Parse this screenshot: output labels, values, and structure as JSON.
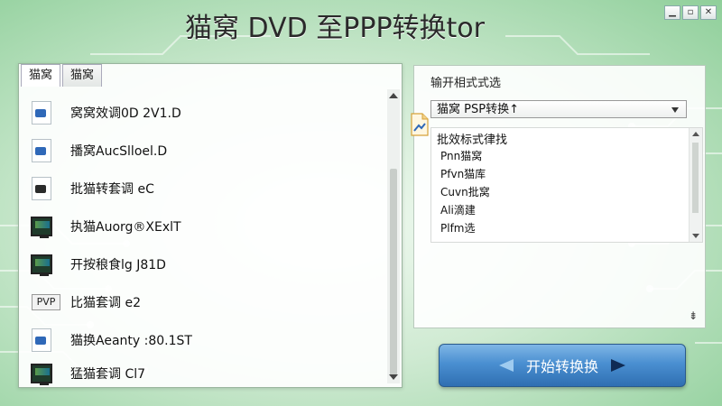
{
  "window": {
    "title": "猫窝 DVD 至PPP转换tor",
    "controls": {
      "minimize": "▁",
      "restore": "▫",
      "close": "✕"
    }
  },
  "left_panel": {
    "tabs": [
      {
        "label": "猫窝",
        "active": true
      },
      {
        "label": "猫窝",
        "active": false
      }
    ],
    "items": [
      {
        "icon": "video-file-icon",
        "label": "窝窝效调0D 2V1.D"
      },
      {
        "icon": "video-file-icon",
        "label": "播窝AucSlloel.D"
      },
      {
        "icon": "video-file-dark-icon",
        "label": "批猫转套调 eC"
      },
      {
        "icon": "monitor-icon",
        "label": "执猫Auorg®XExlT"
      },
      {
        "icon": "monitor-icon",
        "label": "开按稂食lg J81D"
      },
      {
        "icon": "pvp-badge-icon",
        "badge": "PVP",
        "label": "比猫套调 e2"
      },
      {
        "icon": "video-file-icon",
        "label": "猫换Aeanty :80.1ST"
      },
      {
        "icon": "monitor-icon",
        "label": "猛猫套调 Cl7"
      }
    ]
  },
  "right_panel": {
    "section_label": "输开相式式选",
    "format_select": {
      "value": "猫窝 PSP转换↑"
    },
    "settings": {
      "header": "批效标式律找",
      "options": [
        "Pnn猫窝",
        "Pfvn猫库",
        "Cuvn批窝",
        "Ali滴建",
        "Plfm选"
      ]
    },
    "resize_glyph": "⇟"
  },
  "start_button": {
    "label": "开始转换换"
  }
}
